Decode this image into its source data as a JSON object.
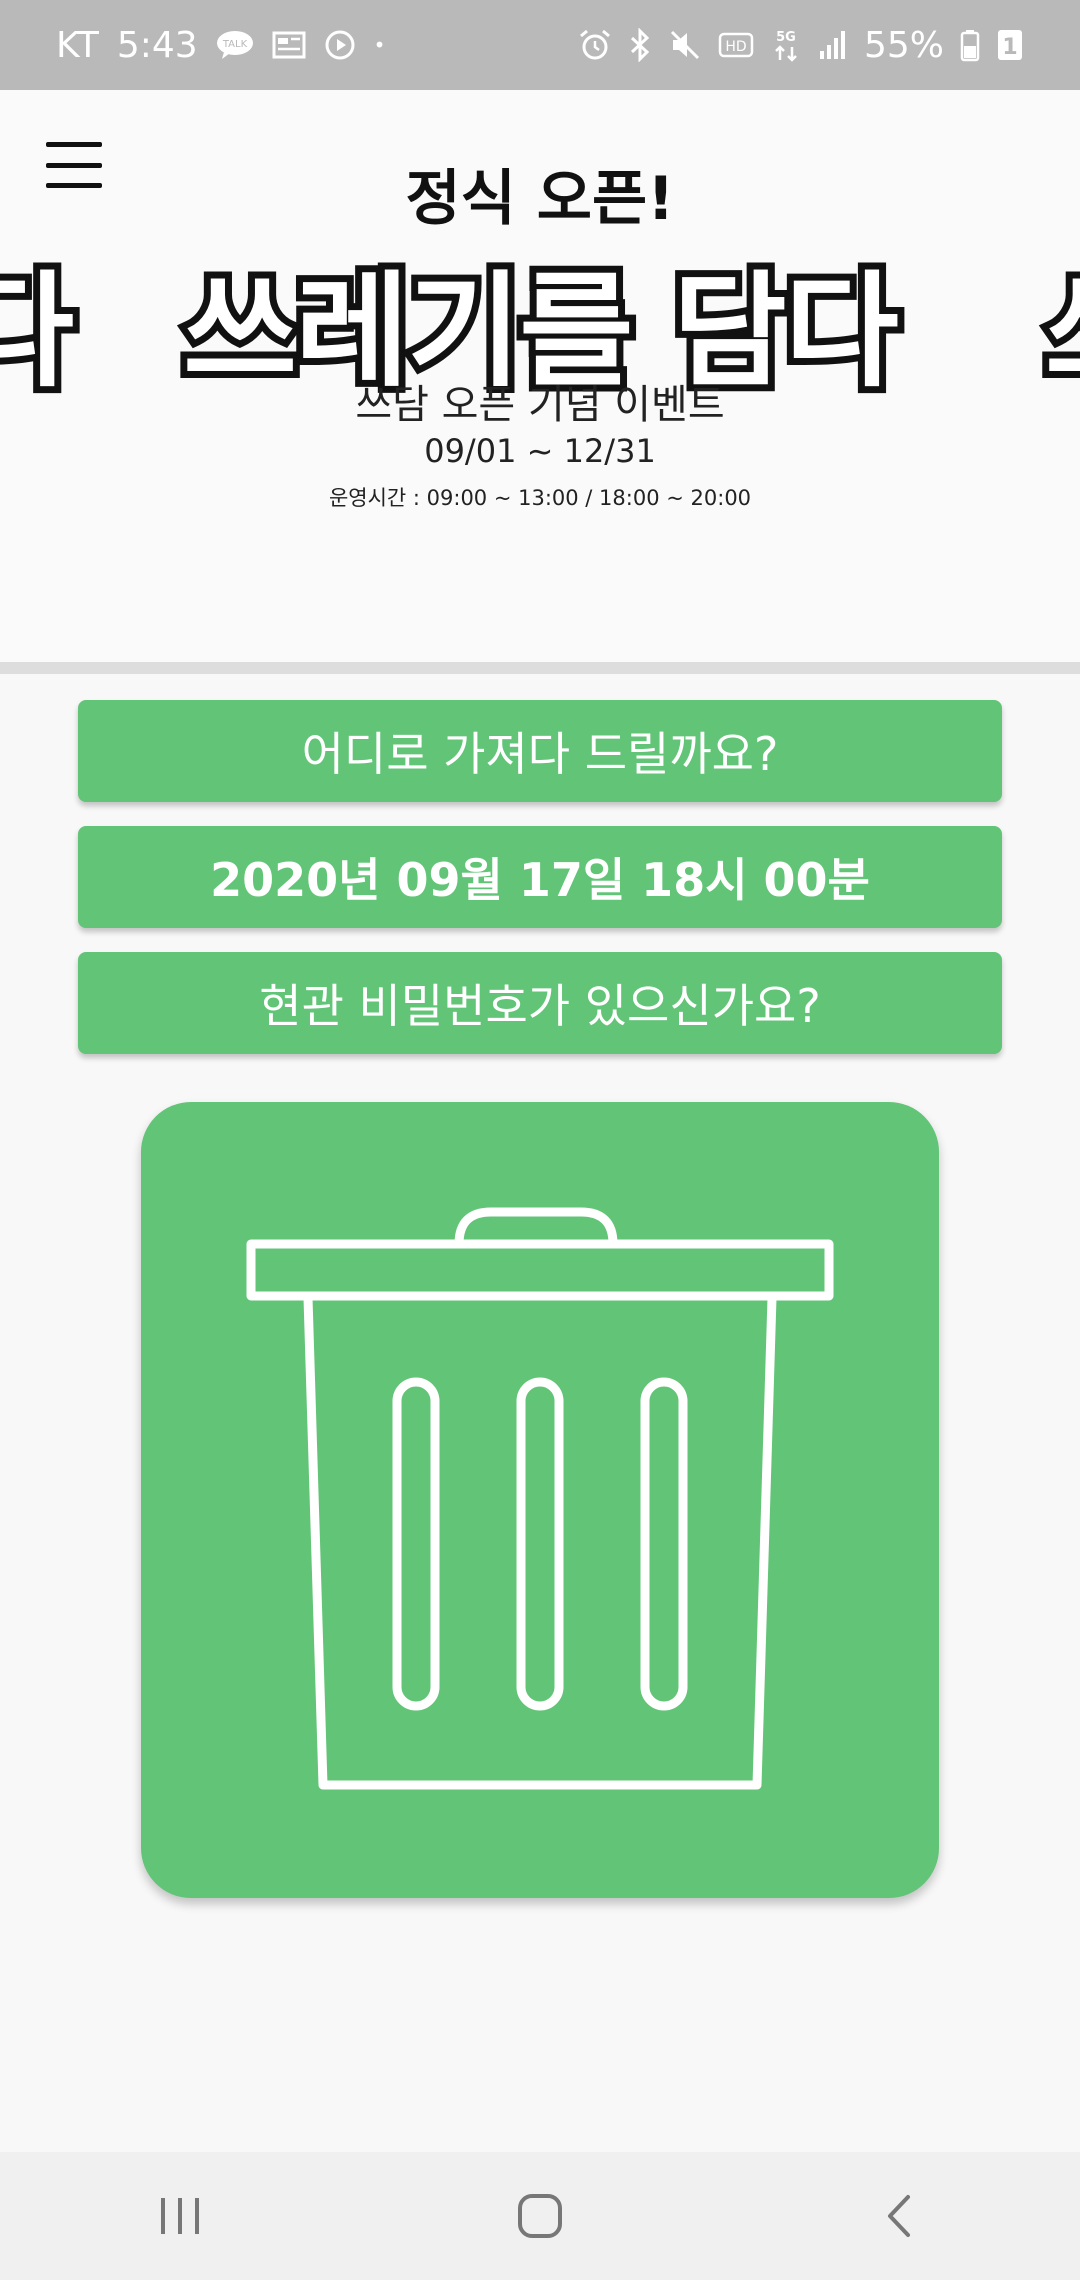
{
  "status_bar": {
    "carrier": "KT",
    "time": "5:43",
    "talk_badge": "TALK",
    "dot": "•",
    "hd": "HD",
    "network": "5G",
    "battery": "55%",
    "sim": "1"
  },
  "banner": {
    "subtitle": "정식 오픈!",
    "title": "쓰레기를 담다",
    "peek_left": "다",
    "peek_right": "쓰",
    "event": "쓰담 오픈 기념 이벤트",
    "dates": "09/01 ~ 12/31",
    "hours": "운영시간 : 09:00 ~ 13:00 / 18:00 ~ 20:00"
  },
  "options": {
    "destination": "어디로 가져다 드릴까요?",
    "datetime": "2020년 09월 17일 18시 00분",
    "password": "현관 비밀번호가 있으신가요?"
  },
  "colors": {
    "accent": "#62c477",
    "status_bar": "#b9b9b9"
  },
  "icons": {
    "menu": "hamburger-menu-icon",
    "trash": "trash-can-icon",
    "recent": "recent-apps-icon",
    "home": "home-icon",
    "back": "back-icon"
  }
}
